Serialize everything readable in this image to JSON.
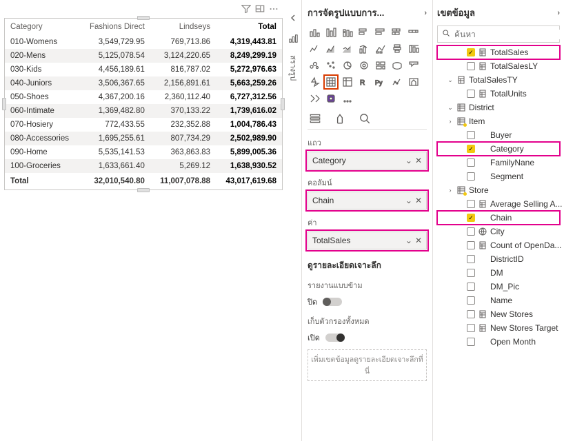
{
  "matrix": {
    "columns": [
      "Category",
      "Fashions Direct",
      "Lindseys",
      "Total"
    ],
    "rows": [
      {
        "cat": "010-Womens",
        "fd": "3,549,729.95",
        "li": "769,713.86",
        "tot": "4,319,443.81"
      },
      {
        "cat": "020-Mens",
        "fd": "5,125,078.54",
        "li": "3,124,220.65",
        "tot": "8,249,299.19"
      },
      {
        "cat": "030-Kids",
        "fd": "4,456,189.61",
        "li": "816,787.02",
        "tot": "5,272,976.63"
      },
      {
        "cat": "040-Juniors",
        "fd": "3,506,367.65",
        "li": "2,156,891.61",
        "tot": "5,663,259.26"
      },
      {
        "cat": "050-Shoes",
        "fd": "4,367,200.16",
        "li": "2,360,112.40",
        "tot": "6,727,312.56"
      },
      {
        "cat": "060-Intimate",
        "fd": "1,369,482.80",
        "li": "370,133.22",
        "tot": "1,739,616.02"
      },
      {
        "cat": "070-Hosiery",
        "fd": "772,433.55",
        "li": "232,352.88",
        "tot": "1,004,786.43"
      },
      {
        "cat": "080-Accessories",
        "fd": "1,695,255.61",
        "li": "807,734.29",
        "tot": "2,502,989.90"
      },
      {
        "cat": "090-Home",
        "fd": "5,535,141.53",
        "li": "363,863.83",
        "tot": "5,899,005.36"
      },
      {
        "cat": "100-Groceries",
        "fd": "1,633,661.40",
        "li": "5,269.12",
        "tot": "1,638,930.52"
      }
    ],
    "footer": {
      "cat": "Total",
      "fd": "32,010,540.80",
      "li": "11,007,078.88",
      "tot": "43,017,619.68"
    }
  },
  "sidetabs": {
    "build": "สรางรูป"
  },
  "viz": {
    "title": "การจัดรูปแบบการ...",
    "rows_label": "แถว",
    "cols_label": "คอลัมน์",
    "vals_label": "ค่า",
    "row_field": "Category",
    "col_field": "Chain",
    "val_field": "TotalSales",
    "drill_title": "ดูรายละเอียดเจาะลึก",
    "cross_label": "รายงานแบบข้าม",
    "cross_state": "ปิด",
    "keep_label": "เก็บตัวกรองทั้งหมด",
    "keep_state": "เปิด",
    "drop_hint": "เพิ่มเขตข้อมูลดูรายละเอียดเจาะลึกที่นี่"
  },
  "fields": {
    "title": "เขตข้อมูล",
    "search_placeholder": "ค้นหา",
    "items": {
      "totalsales": "TotalSales",
      "totalsalesly": "TotalSalesLY",
      "totalsalesty": "TotalSalesTY",
      "totalunits": "TotalUnits",
      "district": "District",
      "item": "Item",
      "buyer": "Buyer",
      "category": "Category",
      "familynane": "FamilyNane",
      "segment": "Segment",
      "store": "Store",
      "avgsell": "Average Selling A...",
      "chain": "Chain",
      "city": "City",
      "countopen": "Count of OpenDa...",
      "districtid": "DistrictID",
      "dm": "DM",
      "dmpic": "DM_Pic",
      "name": "Name",
      "newstores": "New Stores",
      "newstorestarget": "New Stores Target",
      "openmonth": "Open Month"
    }
  }
}
